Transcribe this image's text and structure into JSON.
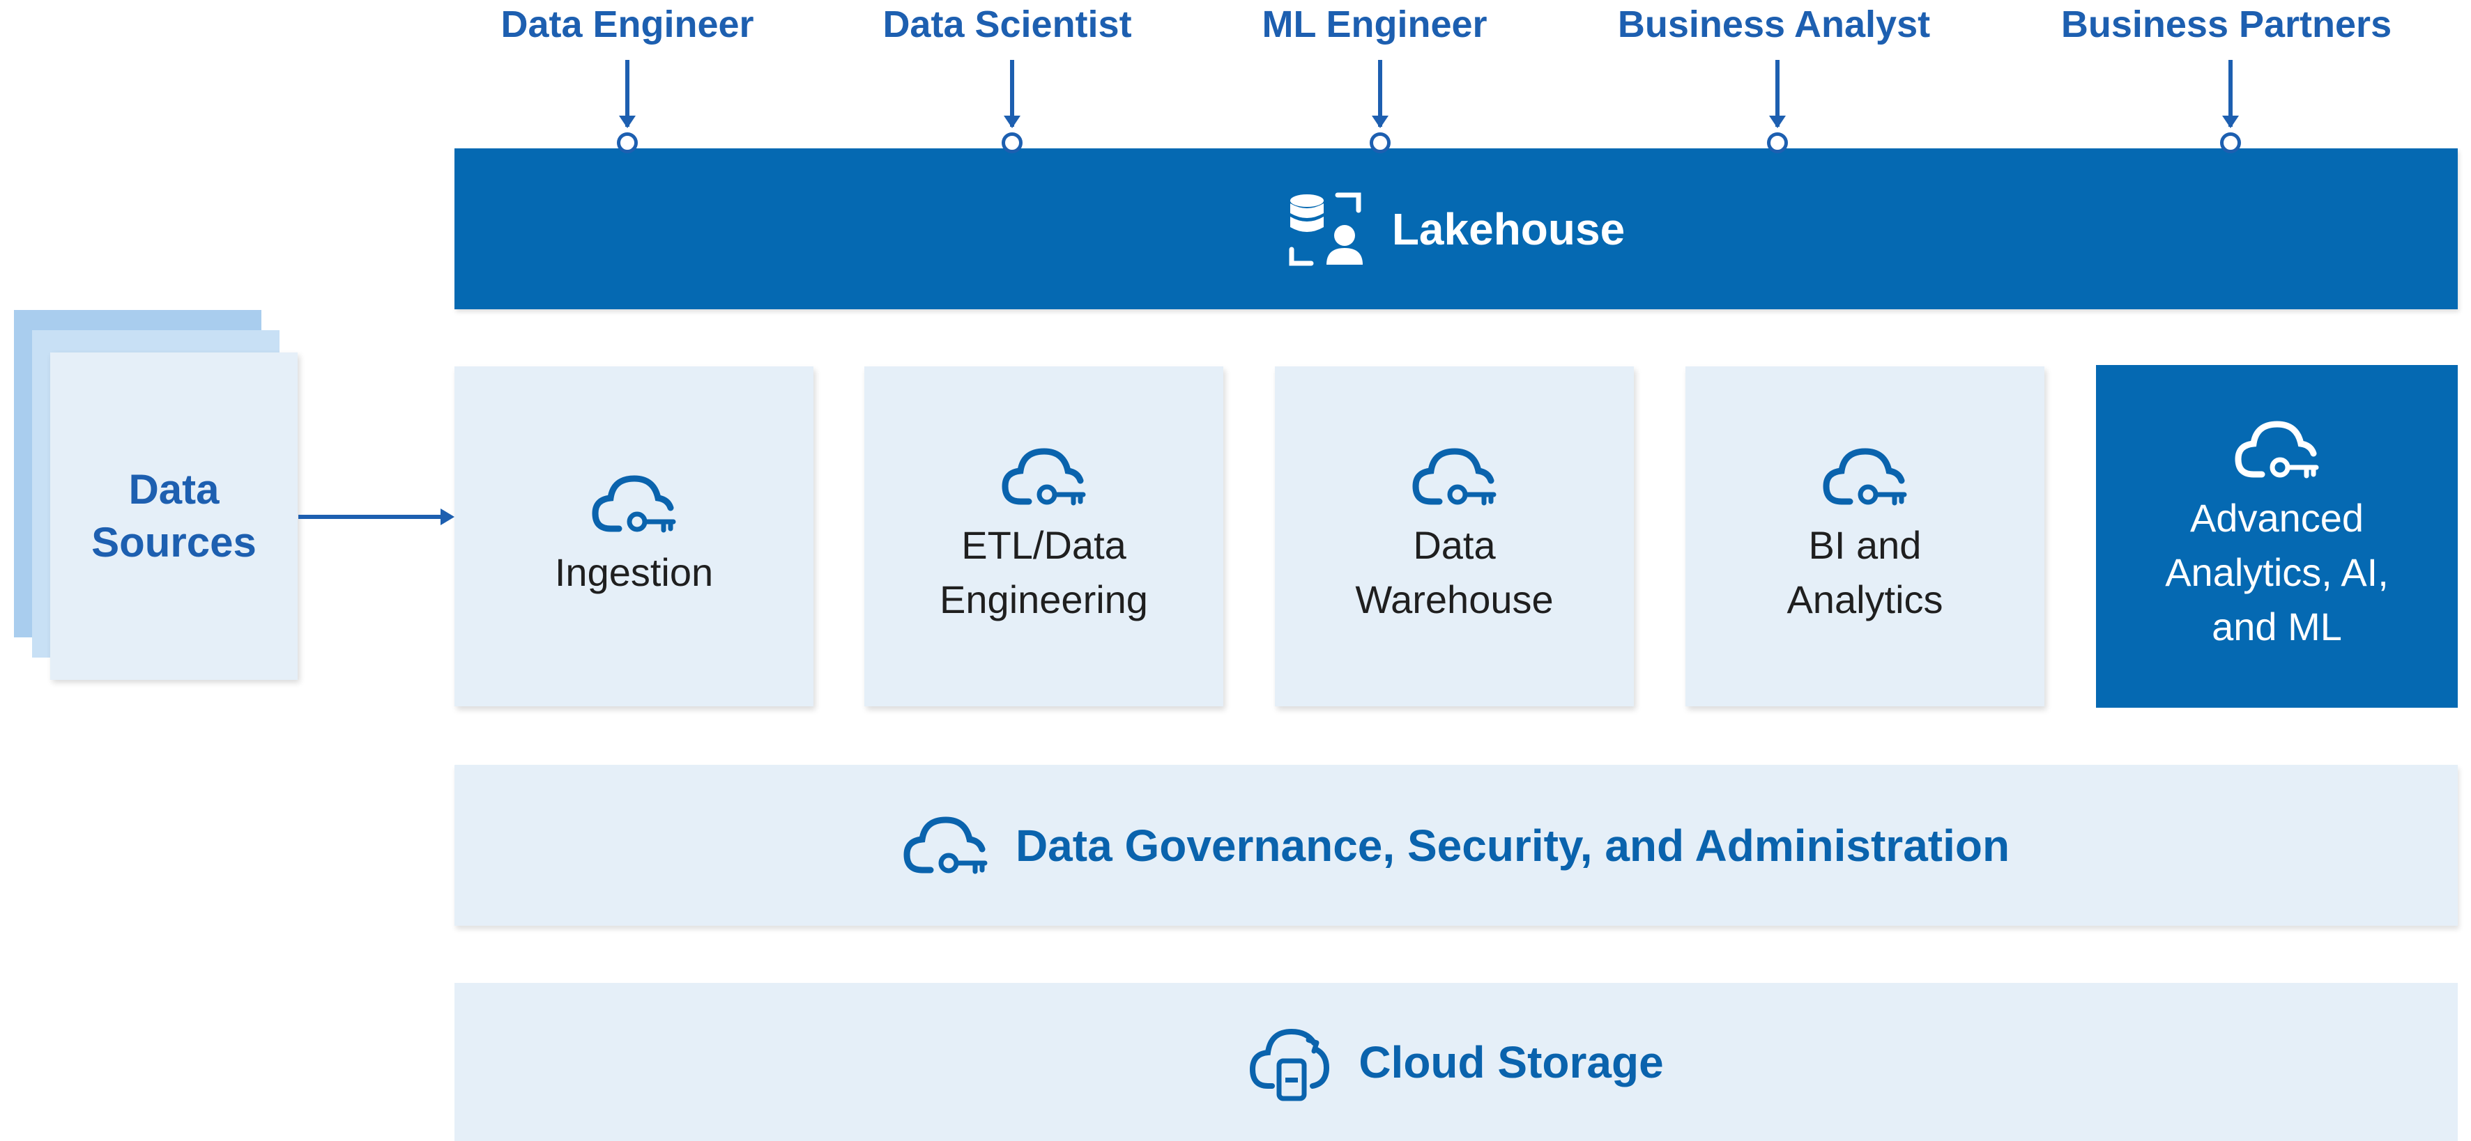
{
  "roles": [
    {
      "label": "Data Engineer"
    },
    {
      "label": "Data Scientist"
    },
    {
      "label": "ML Engineer"
    },
    {
      "label": "Business Analyst"
    },
    {
      "label": "Business Partners"
    }
  ],
  "lakehouse": {
    "title": "Lakehouse",
    "icon": "database-user-icon"
  },
  "data_sources": {
    "title": "Data Sources"
  },
  "components": [
    {
      "label": "Ingestion",
      "icon": "cloud-key-icon"
    },
    {
      "label": "ETL/Data\nEngineering",
      "icon": "cloud-key-icon"
    },
    {
      "label": "Data\nWarehouse",
      "icon": "cloud-key-icon"
    },
    {
      "label": "BI and\nAnalytics",
      "icon": "cloud-key-icon"
    },
    {
      "label": "Advanced\nAnalytics, AI,\nand ML",
      "icon": "cloud-key-icon",
      "highlighted": true
    }
  ],
  "governance": {
    "title": "Data Governance, Security, and Administration",
    "icon": "cloud-key-icon"
  },
  "storage": {
    "title": "Cloud Storage",
    "icon": "cloud-storage-icon"
  },
  "colors": {
    "primary": "#0569b2",
    "text_blue": "#1d5fb0",
    "light_fill": "#e5eff8",
    "stack_back": "#a9cdee"
  }
}
